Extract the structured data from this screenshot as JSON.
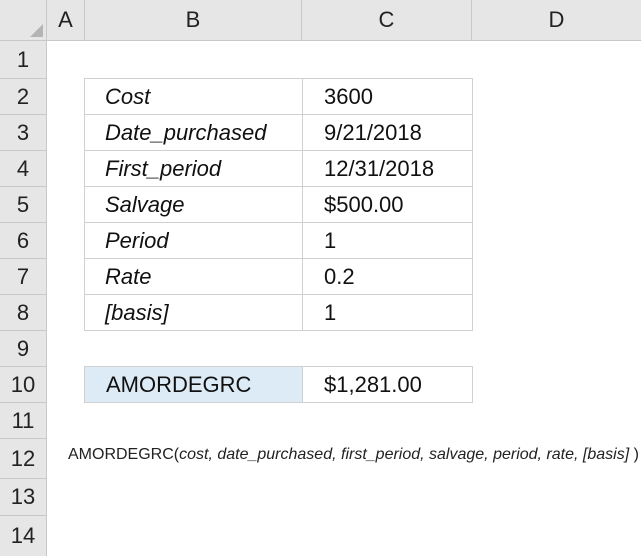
{
  "columns": [
    "A",
    "B",
    "C",
    "D"
  ],
  "rows": [
    "1",
    "2",
    "3",
    "4",
    "5",
    "6",
    "7",
    "8",
    "9",
    "10",
    "11",
    "12",
    "13",
    "14"
  ],
  "inputs": [
    {
      "label": "Cost",
      "value": "3600"
    },
    {
      "label": "Date_purchased",
      "value": "9/21/2018"
    },
    {
      "label": "First_period",
      "value": "12/31/2018"
    },
    {
      "label": "Salvage",
      "value": "$500.00"
    },
    {
      "label": "Period",
      "value": "1"
    },
    {
      "label": "Rate",
      "value": "0.2"
    },
    {
      "label": "[basis]",
      "value": "1"
    }
  ],
  "result": {
    "label": "AMORDEGRC",
    "value": "$1,281.00"
  },
  "syntax": {
    "func": "AMORDEGRC(",
    "args": "cost, date_purchased, first_period, salvage, period, rate, [basis]",
    "close": " )"
  },
  "colors": {
    "header_bg": "#e6e6e6",
    "result_label_bg": "#ddebf7",
    "gridline": "#d0d0d0"
  }
}
